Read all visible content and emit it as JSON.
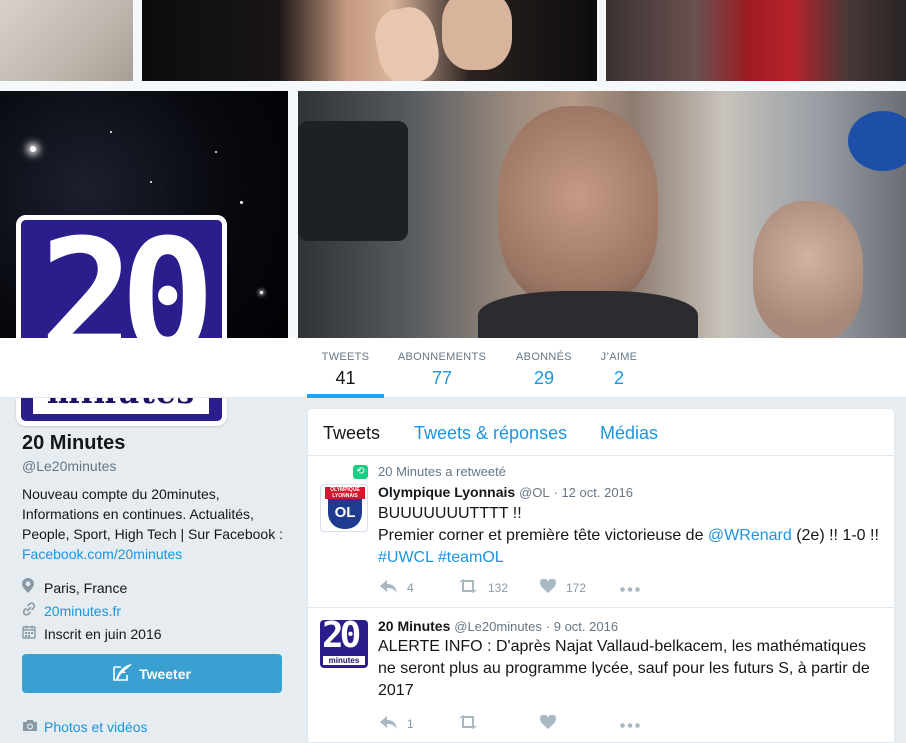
{
  "profile": {
    "name": "20 Minutes",
    "handle": "@Le20minutes",
    "bio_text": "Nouveau compte du 20minutes, Informations en continues. Actualités, People, Sport, High Tech | Sur Facebook : ",
    "bio_link": "Facebook.com/20minutes",
    "location": "Paris, France",
    "website": "20minutes.fr",
    "joined": "Inscrit en juin 2016",
    "avatar_number": "20",
    "avatar_word": "minutes"
  },
  "stats": [
    {
      "label": "TWEETS",
      "value": "41"
    },
    {
      "label": "ABONNEMENTS",
      "value": "77"
    },
    {
      "label": "ABONNÉS",
      "value": "29"
    },
    {
      "label": "J’AIME",
      "value": "2"
    }
  ],
  "buttons": {
    "tweet": "Tweeter"
  },
  "photos_link": "Photos et vidéos",
  "timeline": {
    "tabs": [
      "Tweets",
      "Tweets & réponses",
      "Médias"
    ],
    "tweets": [
      {
        "retweet_context": "20 Minutes a retweeté",
        "author": "Olympique Lyonnais",
        "handle": "@OL",
        "date": "12 oct. 2016",
        "line1": "BUUUUUUUTTTT !!",
        "line2a": "Premier corner et première tête victorieuse de ",
        "mention": "@WRenard",
        "line2b": " (2e) !! 1-0 !!",
        "hashtags": "#UWCL #teamOL",
        "replies": "4",
        "retweets": "132",
        "likes": "172",
        "logo_top": "OLYMPIQUE LYONNAIS",
        "logo_mark": "OL"
      },
      {
        "author": "20 Minutes",
        "handle": "@Le20minutes",
        "date": "9 oct. 2016",
        "text": "ALERTE INFO : D'après Najat Vallaud-belkacem, les mathématiques ne seront plus au programme lycée, sauf pour les futurs S, à partir de 2017",
        "replies": "1",
        "logo_number": "20",
        "logo_word": "minutes"
      }
    ]
  },
  "icons": {
    "reply": "reply-icon",
    "retweet": "retweet-icon",
    "like": "heart-icon",
    "more": "more-icon",
    "location": "location-icon",
    "link": "link-icon",
    "calendar": "calendar-icon",
    "camera": "camera-icon",
    "quill": "quill-icon"
  },
  "colors": {
    "accent": "#1da1f2",
    "link": "#1b95e0",
    "button": "#3a9fd1",
    "retweet_badge": "#19cf86",
    "brand": "#2a1e8c"
  }
}
